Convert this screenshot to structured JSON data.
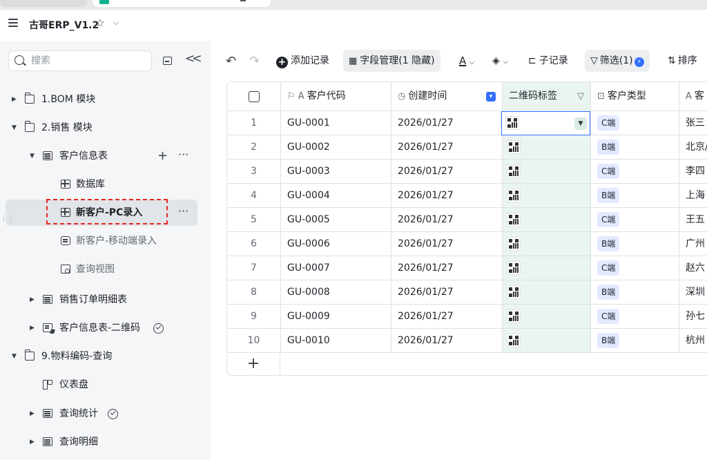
{
  "app": {
    "title": "古哥ERP_V1.2"
  },
  "sidebar": {
    "search_placeholder": "搜索",
    "items": [
      {
        "label": "1.BOM 模块"
      },
      {
        "label": "2.销售 模块"
      },
      {
        "label": "客户信息表"
      },
      {
        "label": "数据库"
      },
      {
        "label": "新客户-PC录入"
      },
      {
        "label": "新客户-移动端录入"
      },
      {
        "label": "查询视图"
      },
      {
        "label": "销售订单明细表"
      },
      {
        "label": "客户信息表-二维码"
      },
      {
        "label": "9.物料编码-查询"
      },
      {
        "label": "仪表盘"
      },
      {
        "label": "查询统计"
      },
      {
        "label": "查询明细"
      }
    ]
  },
  "toolbar": {
    "add_record": "添加记录",
    "field_manage": "字段管理(1 隐藏)",
    "text_color": "A",
    "sub_record": "子记录",
    "filter": "筛选(1)",
    "sort": "排序"
  },
  "table": {
    "columns": [
      "客户代码",
      "创建时间",
      "二维码标签",
      "客户类型",
      "客"
    ],
    "rows": [
      {
        "n": "1",
        "code": "GU-0001",
        "date": "2026/01/27",
        "type": "C端",
        "name": "张三"
      },
      {
        "n": "2",
        "code": "GU-0002",
        "date": "2026/01/27",
        "type": "B端",
        "name": "北京/"
      },
      {
        "n": "3",
        "code": "GU-0003",
        "date": "2026/01/27",
        "type": "C端",
        "name": "李四"
      },
      {
        "n": "4",
        "code": "GU-0004",
        "date": "2026/01/27",
        "type": "B端",
        "name": "上海"
      },
      {
        "n": "5",
        "code": "GU-0005",
        "date": "2026/01/27",
        "type": "C端",
        "name": "王五"
      },
      {
        "n": "6",
        "code": "GU-0006",
        "date": "2026/01/27",
        "type": "B端",
        "name": "广州"
      },
      {
        "n": "7",
        "code": "GU-0007",
        "date": "2026/01/27",
        "type": "C端",
        "name": "赵六"
      },
      {
        "n": "8",
        "code": "GU-0008",
        "date": "2026/01/27",
        "type": "B端",
        "name": "深圳"
      },
      {
        "n": "9",
        "code": "GU-0009",
        "date": "2026/01/27",
        "type": "C端",
        "name": "孙七"
      },
      {
        "n": "10",
        "code": "GU-0010",
        "date": "2026/01/27",
        "type": "B端",
        "name": "杭州"
      }
    ]
  },
  "colors": {
    "accent": "#3370ff",
    "qr_column": "#eaf4f1",
    "highlight": "#e8251f",
    "tag_bg": "#e1eaff"
  }
}
